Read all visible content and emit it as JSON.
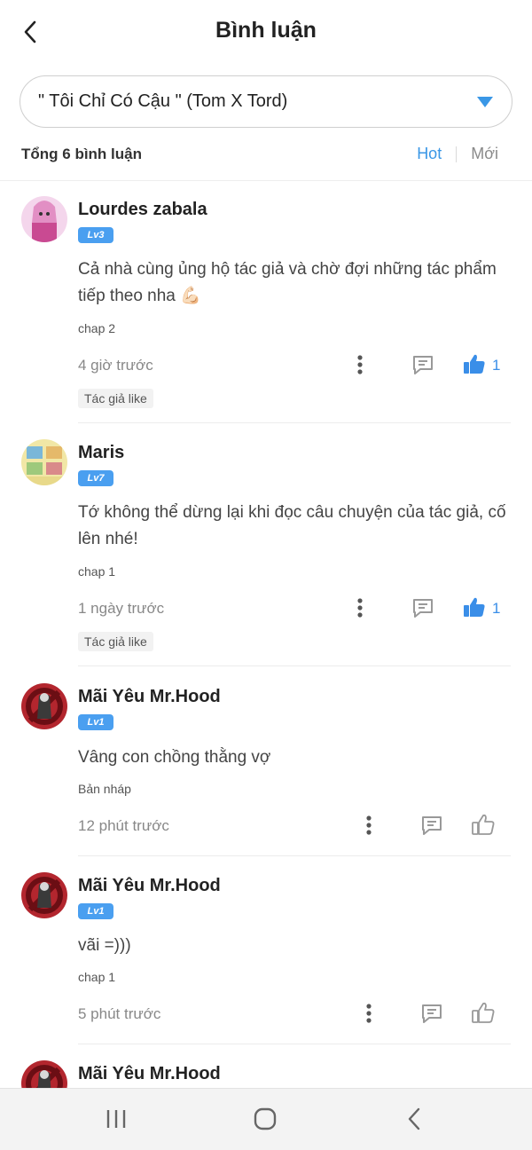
{
  "header": {
    "title": "Bình luận"
  },
  "selector": {
    "value": "\" Tôi Chỉ Có Cậu \" (Tom X Tord)"
  },
  "summary": {
    "total": "Tổng 6 bình luận",
    "sort_hot": "Hot",
    "sort_new": "Mới"
  },
  "colors": {
    "accent": "#3a97e6",
    "badge": "#4a9ff0",
    "like": "#3a8ee8"
  },
  "comments": [
    {
      "name": "Lourdes zabala",
      "level": "Lv3",
      "text": "Cả nhà cùng ủng hộ tác giả và chờ đợi những tác phẩm tiếp theo nha 💪🏻",
      "chap": "chap 2",
      "time": "4 giờ trước",
      "likes": "1",
      "liked": true,
      "author_like": "Tác giả like"
    },
    {
      "name": "Maris",
      "level": "Lv7",
      "text": "Tớ không thể dừng lại khi đọc câu chuyện của tác giả, cố lên nhé!",
      "chap": "chap 1",
      "time": "1 ngày trước",
      "likes": "1",
      "liked": true,
      "author_like": "Tác giả like"
    },
    {
      "name": "Mãi Yêu Mr.Hood",
      "level": "Lv1",
      "text": "Vâng con chồng thằng vợ",
      "chap": "Bản nháp",
      "time": "12 phút trước",
      "likes": "",
      "liked": false
    },
    {
      "name": "Mãi Yêu Mr.Hood",
      "level": "Lv1",
      "text": "vãi =)))",
      "chap": "chap 1",
      "time": "5 phút trước",
      "likes": "",
      "liked": false
    },
    {
      "name": "Mãi Yêu Mr.Hood"
    }
  ],
  "icons": [
    "back-arrow-icon",
    "dropdown-triangle-icon",
    "more-vertical-icon",
    "reply-comment-icon",
    "thumbs-up-icon",
    "recent-apps-icon",
    "home-icon",
    "back-icon"
  ]
}
